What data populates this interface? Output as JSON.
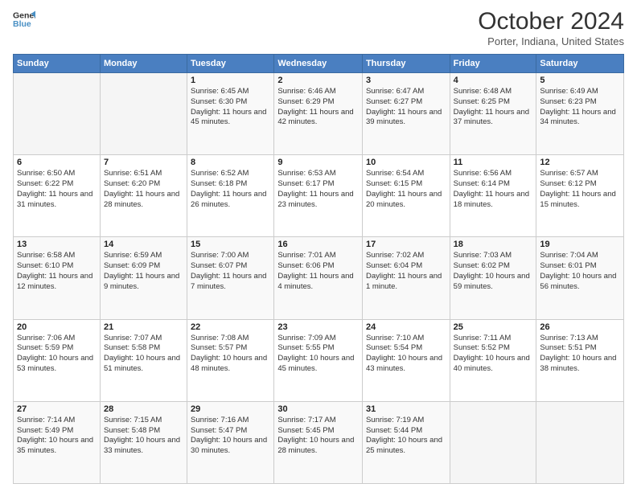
{
  "header": {
    "logo_line1": "General",
    "logo_line2": "Blue",
    "title": "October 2024",
    "subtitle": "Porter, Indiana, United States"
  },
  "weekdays": [
    "Sunday",
    "Monday",
    "Tuesday",
    "Wednesday",
    "Thursday",
    "Friday",
    "Saturday"
  ],
  "weeks": [
    [
      {
        "day": "",
        "info": ""
      },
      {
        "day": "",
        "info": ""
      },
      {
        "day": "1",
        "info": "Sunrise: 6:45 AM\nSunset: 6:30 PM\nDaylight: 11 hours and 45 minutes."
      },
      {
        "day": "2",
        "info": "Sunrise: 6:46 AM\nSunset: 6:29 PM\nDaylight: 11 hours and 42 minutes."
      },
      {
        "day": "3",
        "info": "Sunrise: 6:47 AM\nSunset: 6:27 PM\nDaylight: 11 hours and 39 minutes."
      },
      {
        "day": "4",
        "info": "Sunrise: 6:48 AM\nSunset: 6:25 PM\nDaylight: 11 hours and 37 minutes."
      },
      {
        "day": "5",
        "info": "Sunrise: 6:49 AM\nSunset: 6:23 PM\nDaylight: 11 hours and 34 minutes."
      }
    ],
    [
      {
        "day": "6",
        "info": "Sunrise: 6:50 AM\nSunset: 6:22 PM\nDaylight: 11 hours and 31 minutes."
      },
      {
        "day": "7",
        "info": "Sunrise: 6:51 AM\nSunset: 6:20 PM\nDaylight: 11 hours and 28 minutes."
      },
      {
        "day": "8",
        "info": "Sunrise: 6:52 AM\nSunset: 6:18 PM\nDaylight: 11 hours and 26 minutes."
      },
      {
        "day": "9",
        "info": "Sunrise: 6:53 AM\nSunset: 6:17 PM\nDaylight: 11 hours and 23 minutes."
      },
      {
        "day": "10",
        "info": "Sunrise: 6:54 AM\nSunset: 6:15 PM\nDaylight: 11 hours and 20 minutes."
      },
      {
        "day": "11",
        "info": "Sunrise: 6:56 AM\nSunset: 6:14 PM\nDaylight: 11 hours and 18 minutes."
      },
      {
        "day": "12",
        "info": "Sunrise: 6:57 AM\nSunset: 6:12 PM\nDaylight: 11 hours and 15 minutes."
      }
    ],
    [
      {
        "day": "13",
        "info": "Sunrise: 6:58 AM\nSunset: 6:10 PM\nDaylight: 11 hours and 12 minutes."
      },
      {
        "day": "14",
        "info": "Sunrise: 6:59 AM\nSunset: 6:09 PM\nDaylight: 11 hours and 9 minutes."
      },
      {
        "day": "15",
        "info": "Sunrise: 7:00 AM\nSunset: 6:07 PM\nDaylight: 11 hours and 7 minutes."
      },
      {
        "day": "16",
        "info": "Sunrise: 7:01 AM\nSunset: 6:06 PM\nDaylight: 11 hours and 4 minutes."
      },
      {
        "day": "17",
        "info": "Sunrise: 7:02 AM\nSunset: 6:04 PM\nDaylight: 11 hours and 1 minute."
      },
      {
        "day": "18",
        "info": "Sunrise: 7:03 AM\nSunset: 6:02 PM\nDaylight: 10 hours and 59 minutes."
      },
      {
        "day": "19",
        "info": "Sunrise: 7:04 AM\nSunset: 6:01 PM\nDaylight: 10 hours and 56 minutes."
      }
    ],
    [
      {
        "day": "20",
        "info": "Sunrise: 7:06 AM\nSunset: 5:59 PM\nDaylight: 10 hours and 53 minutes."
      },
      {
        "day": "21",
        "info": "Sunrise: 7:07 AM\nSunset: 5:58 PM\nDaylight: 10 hours and 51 minutes."
      },
      {
        "day": "22",
        "info": "Sunrise: 7:08 AM\nSunset: 5:57 PM\nDaylight: 10 hours and 48 minutes."
      },
      {
        "day": "23",
        "info": "Sunrise: 7:09 AM\nSunset: 5:55 PM\nDaylight: 10 hours and 45 minutes."
      },
      {
        "day": "24",
        "info": "Sunrise: 7:10 AM\nSunset: 5:54 PM\nDaylight: 10 hours and 43 minutes."
      },
      {
        "day": "25",
        "info": "Sunrise: 7:11 AM\nSunset: 5:52 PM\nDaylight: 10 hours and 40 minutes."
      },
      {
        "day": "26",
        "info": "Sunrise: 7:13 AM\nSunset: 5:51 PM\nDaylight: 10 hours and 38 minutes."
      }
    ],
    [
      {
        "day": "27",
        "info": "Sunrise: 7:14 AM\nSunset: 5:49 PM\nDaylight: 10 hours and 35 minutes."
      },
      {
        "day": "28",
        "info": "Sunrise: 7:15 AM\nSunset: 5:48 PM\nDaylight: 10 hours and 33 minutes."
      },
      {
        "day": "29",
        "info": "Sunrise: 7:16 AM\nSunset: 5:47 PM\nDaylight: 10 hours and 30 minutes."
      },
      {
        "day": "30",
        "info": "Sunrise: 7:17 AM\nSunset: 5:45 PM\nDaylight: 10 hours and 28 minutes."
      },
      {
        "day": "31",
        "info": "Sunrise: 7:19 AM\nSunset: 5:44 PM\nDaylight: 10 hours and 25 minutes."
      },
      {
        "day": "",
        "info": ""
      },
      {
        "day": "",
        "info": ""
      }
    ]
  ]
}
